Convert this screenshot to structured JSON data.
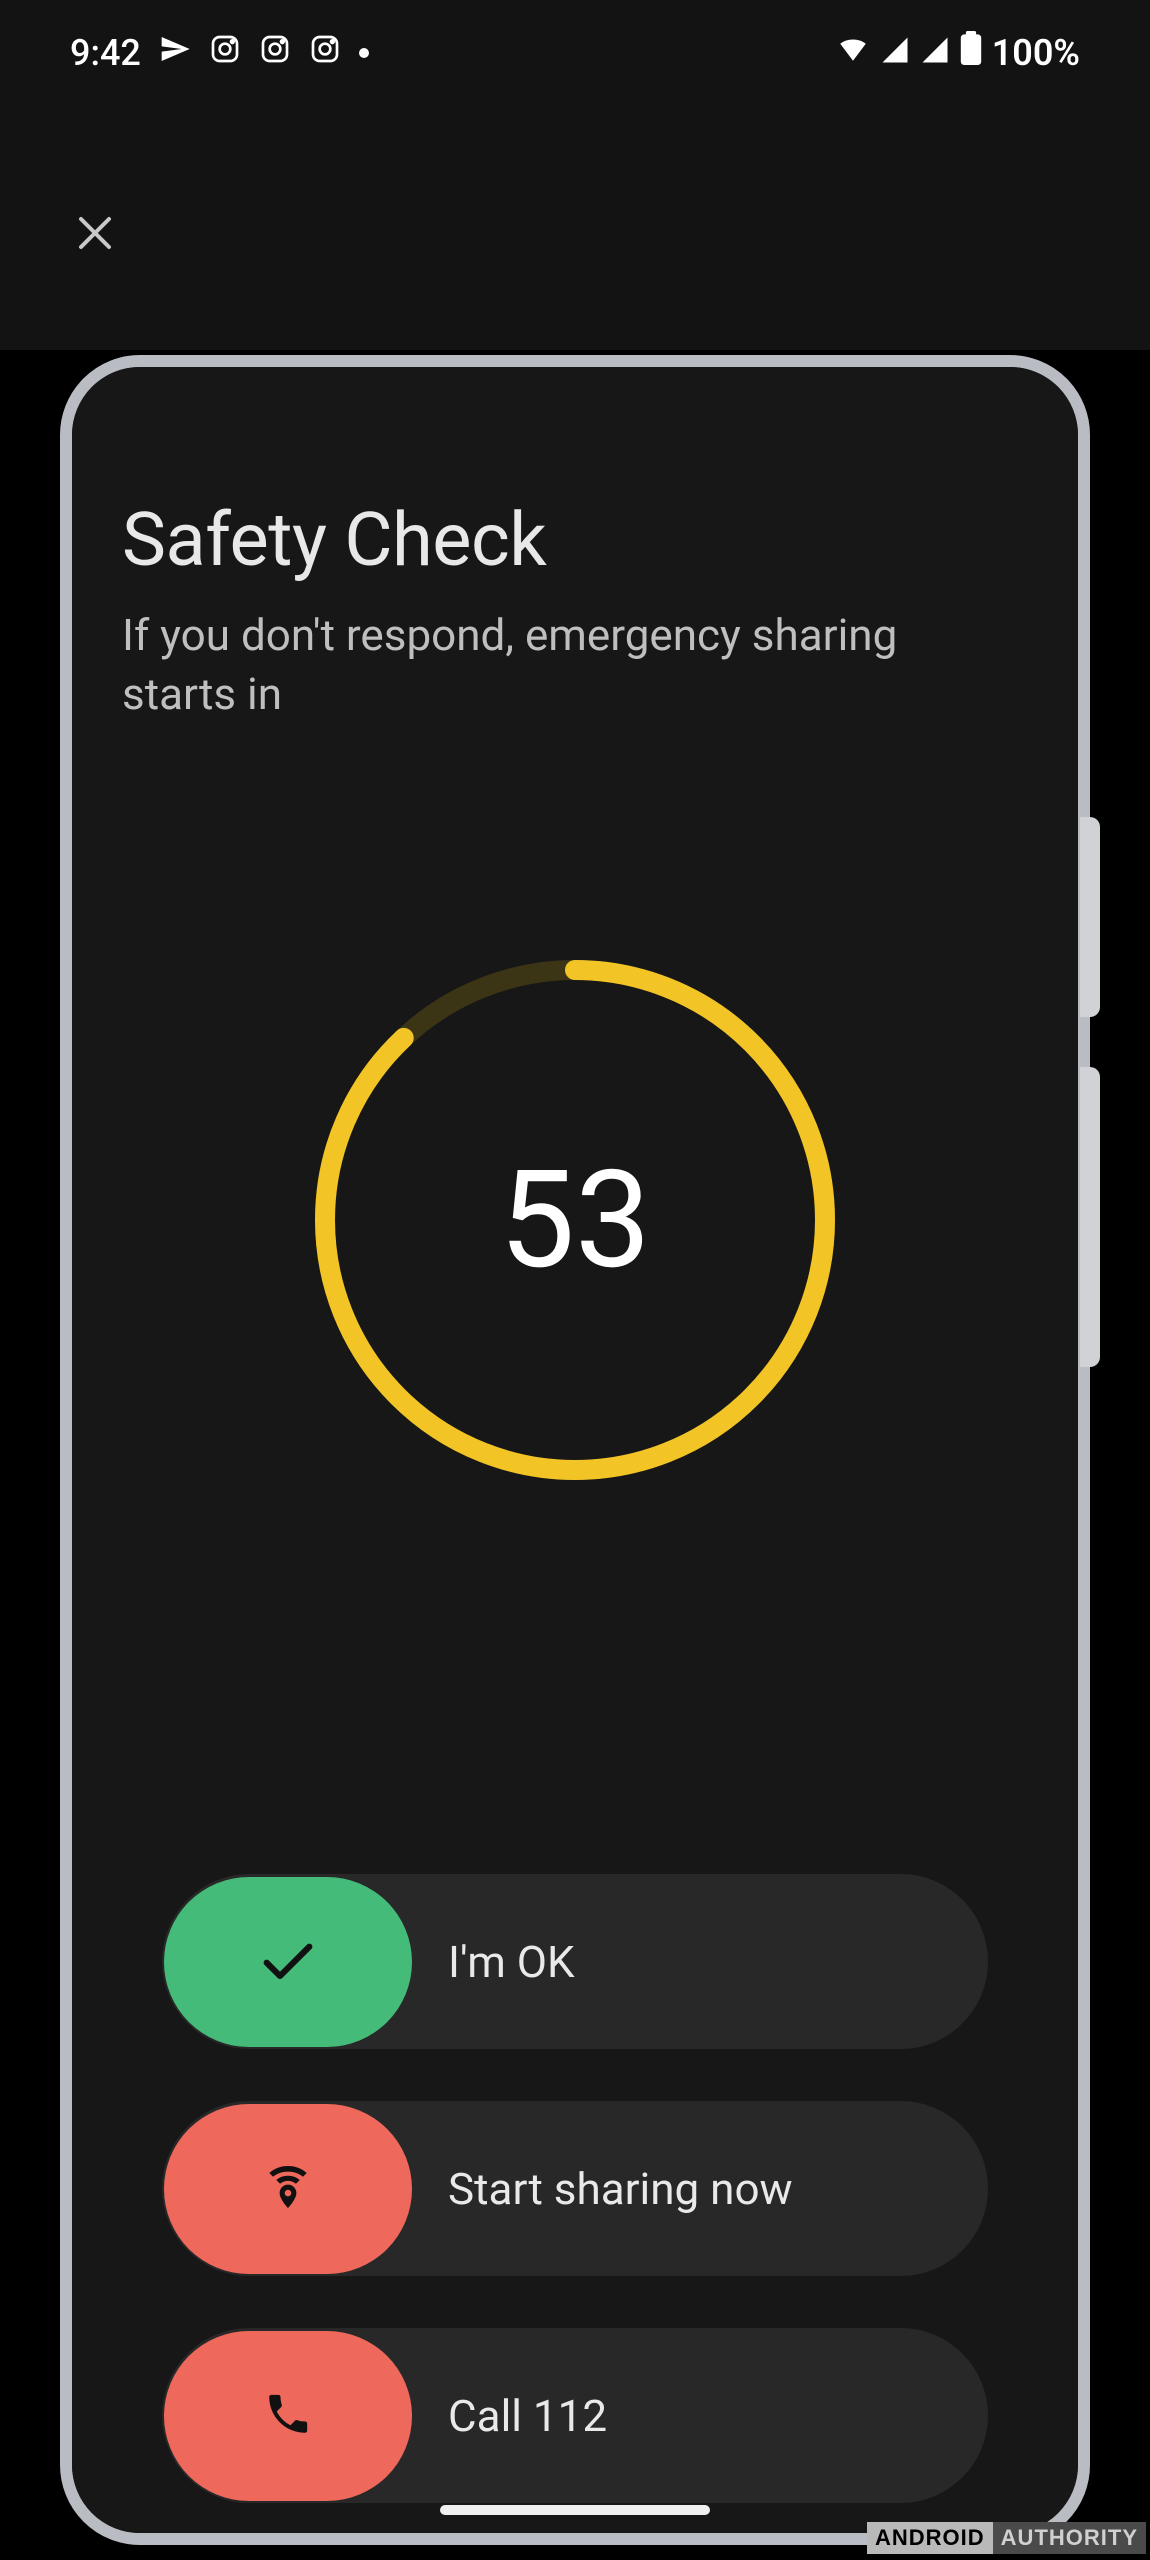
{
  "status_bar": {
    "time": "9:42",
    "battery": "100%"
  },
  "screen": {
    "title": "Safety Check",
    "subtitle": "If you don't respond, emergency sharing starts in",
    "countdown": "53",
    "progress_fraction": 0.88
  },
  "actions": {
    "ok_label": "I'm OK",
    "share_label": "Start sharing now",
    "call_label": "Call 112"
  },
  "watermark": {
    "part1": "ANDROID",
    "part2": "AUTHORITY"
  },
  "colors": {
    "accent_yellow": "#f3c426",
    "pill_green": "#45bb7a",
    "pill_red": "#ee685c"
  }
}
